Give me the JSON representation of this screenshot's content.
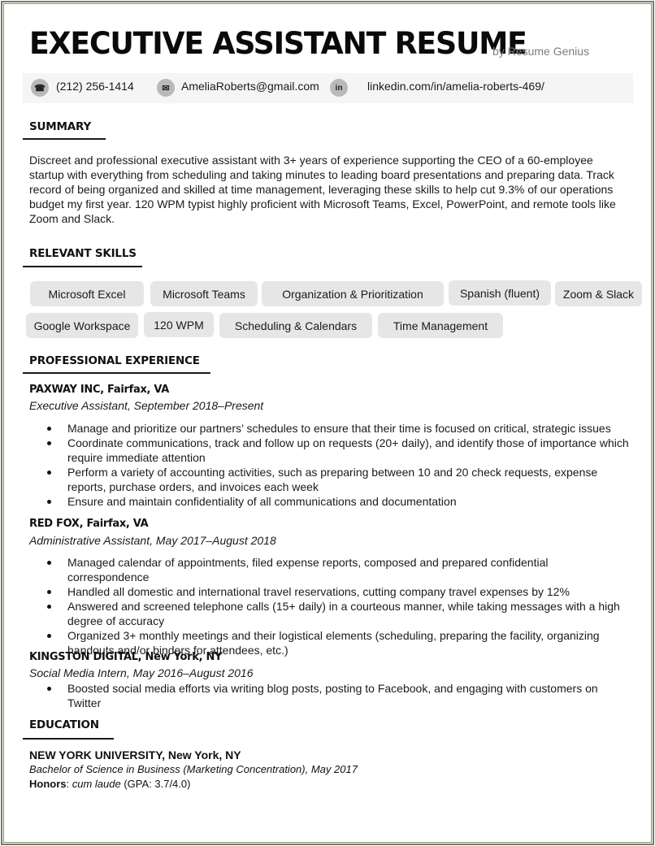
{
  "header": {
    "title": "EXECUTIVE ASSISTANT RESUME",
    "byline": "by Resume Genius"
  },
  "contact": {
    "phone": {
      "icon": "phone-icon",
      "glyph": "☎",
      "text": "(212) 256-1414"
    },
    "email": {
      "icon": "mail-icon",
      "glyph": "✉",
      "text": "AmeliaRoberts@gmail.com"
    },
    "linkedin": {
      "icon": "linkedin-icon",
      "glyph": "in",
      "text": "linkedin.com/in/amelia-roberts-469/"
    }
  },
  "summary": {
    "heading": "SUMMARY",
    "text": "Discreet and professional executive assistant with 3+ years of experience supporting the CEO of a 60-employee startup with everything from scheduling and taking minutes to leading board presentations and preparing data. Track record of being organized and skilled at time management, leveraging these skills to help cut 9.3% of our operations budget my first year. 120 WPM typist highly proficient with Microsoft Teams, Excel, PowerPoint, and remote tools like Zoom and Slack."
  },
  "skills": {
    "heading": "RELEVANT SKILLS",
    "items": [
      "Microsoft Excel",
      "Microsoft Teams",
      "Organization & Prioritization",
      "Spanish (fluent)",
      "Zoom & Slack",
      "Google Workspace",
      "120 WPM",
      "Scheduling & Calendars",
      "Time Management"
    ]
  },
  "experience": {
    "heading": "PROFESSIONAL EXPERIENCE",
    "jobs": [
      {
        "company": "PAXWAY INC, Fairfax, VA",
        "role": "Executive Assistant, September 2018–Present",
        "bullets": [
          "Manage and prioritize our partners’ schedules to ensure that their time is focused on critical, strategic issues",
          "Coordinate communications, track and follow up on requests (20+ daily), and identify those of importance which require immediate attention",
          "Perform a variety of accounting activities, such as preparing between 10 and 20 check requests, expense reports, purchase orders, and invoices each week",
          "Ensure and maintain confidentiality of all communications and documentation"
        ]
      },
      {
        "company": "RED FOX, Fairfax, VA",
        "role": "Administrative Assistant, May 2017–August 2018",
        "bullets": [
          "Managed calendar of appointments, filed expense reports, composed and prepared confidential correspondence",
          "Handled all domestic and international travel reservations, cutting company travel expenses by 12%",
          "Answered and screened telephone calls (15+ daily) in a courteous manner, while taking messages with a high degree of accuracy",
          "Organized 3+ monthly meetings and their logistical elements (scheduling, preparing the facility, organizing handouts and/or binders for attendees, etc.)"
        ]
      },
      {
        "company": "KINGSTON DIGITAL, New York, NY",
        "role": "Social Media Intern, May 2016–August 2016",
        "bullets": [
          "Boosted social media efforts via writing blog posts, posting to Facebook, and engaging with customers on Twitter"
        ]
      }
    ]
  },
  "education": {
    "heading": "EDUCATION",
    "school": "NEW YORK UNIVERSITY, New York, NY",
    "degree": "Bachelor of Science in Business (Marketing Concentration), May 2017",
    "honors_label": "Honors",
    "honors_sep": ": ",
    "honors_latin": "cum laude",
    "honors_gpa": " (GPA: 3.7/4.0)"
  }
}
